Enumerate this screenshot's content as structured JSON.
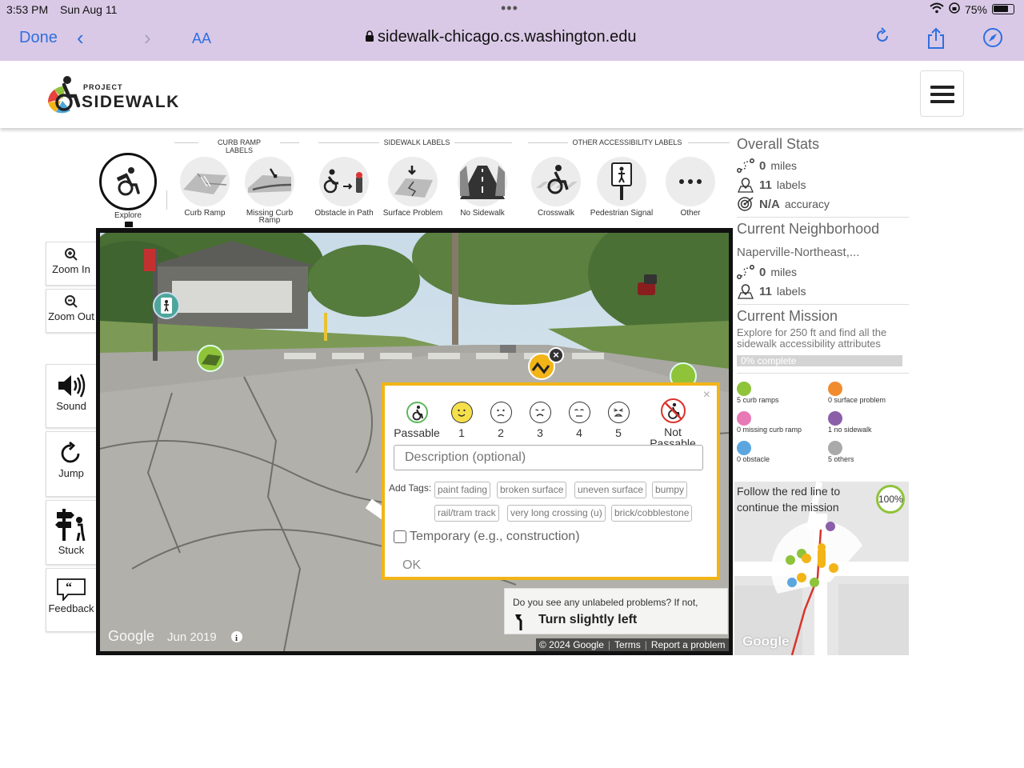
{
  "status": {
    "time": "3:53 PM",
    "date": "Sun Aug 11",
    "battery": "75%"
  },
  "safari": {
    "done": "Done",
    "text_size": "AA",
    "url": "sidewalk-chicago.cs.washington.edu"
  },
  "header": {
    "logo_top": "PROJECT",
    "logo_bottom": "SIDEWALK"
  },
  "label_groups": {
    "curb": "CURB RAMP LABELS",
    "sidewalk": "SIDEWALK LABELS",
    "other": "OTHER ACCESSIBILITY LABELS"
  },
  "tools": [
    {
      "label": "Explore"
    },
    {
      "label": "Curb Ramp"
    },
    {
      "label": "Missing Curb Ramp"
    },
    {
      "label": "Obstacle in Path"
    },
    {
      "label": "Surface Problem"
    },
    {
      "label": "No Sidewalk"
    },
    {
      "label": "Crosswalk"
    },
    {
      "label": "Pedestrian Signal"
    },
    {
      "label": "Other"
    }
  ],
  "side_tools": {
    "zoom_in": "Zoom In",
    "zoom_out": "Zoom Out",
    "sound": "Sound",
    "jump": "Jump",
    "stuck": "Stuck",
    "feedback": "Feedback"
  },
  "pano": {
    "google": "Google",
    "date": "Jun 2019",
    "copyright": "© 2024 Google",
    "terms": "Terms",
    "report": "Report a problem",
    "prompt": "Do you see any unlabeled problems? If not,",
    "instruction": "Turn slightly left"
  },
  "modal": {
    "severity": [
      {
        "label": "Passable"
      },
      {
        "label": "1"
      },
      {
        "label": "2"
      },
      {
        "label": "3"
      },
      {
        "label": "4"
      },
      {
        "label": "5"
      },
      {
        "label": "Not Passable"
      }
    ],
    "description_placeholder": "Description (optional)",
    "add_tags": "Add Tags:",
    "tags": [
      "paint fading",
      "broken surface",
      "uneven surface",
      "bumpy",
      "rail/tram track",
      "very long crossing (u)",
      "brick/cobblestone"
    ],
    "temporary": "Temporary (e.g., construction)",
    "ok": "OK"
  },
  "stats": {
    "overall_title": "Overall Stats",
    "overall_miles": "0",
    "overall_labels": "11",
    "overall_accuracy": "N/A",
    "miles_unit": "miles",
    "labels_unit": "labels",
    "accuracy_unit": "accuracy",
    "neighborhood_title": "Current Neighborhood",
    "neighborhood_name": "Naperville-Northeast,...",
    "neighborhood_miles": "0",
    "neighborhood_labels": "11",
    "mission_title": "Current Mission",
    "mission_text": "Explore for 250 ft and find all the sidewalk accessibility attributes",
    "mission_progress": "0% complete",
    "mission_progress_value": 0
  },
  "counts": [
    {
      "label": "5 curb ramps"
    },
    {
      "label": "0 surface problem"
    },
    {
      "label": "0 missing curb ramp"
    },
    {
      "label": "1 no sidewalk"
    },
    {
      "label": "0 obstacle"
    },
    {
      "label": "5 others"
    }
  ],
  "minimap": {
    "instruction": "Follow the red line to continue the mission",
    "percent": "100%",
    "google": "Google"
  },
  "colors": {
    "accent_yellow": "#f2b417",
    "curb_green": "#8fc33a",
    "safari_purple": "#d9c9e6"
  }
}
